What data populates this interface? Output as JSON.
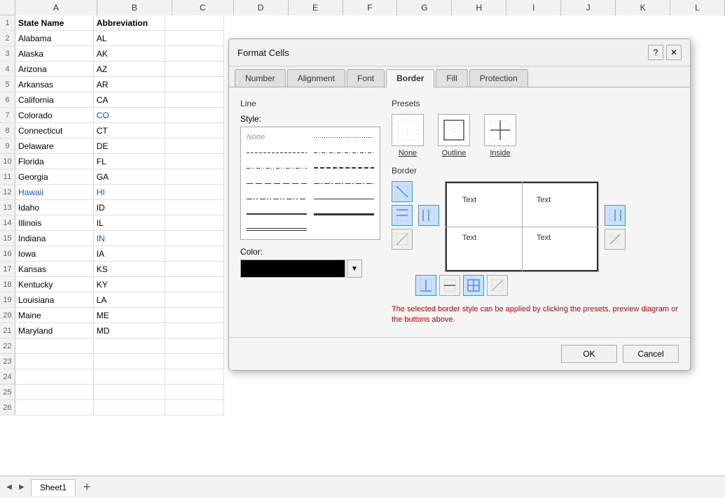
{
  "spreadsheet": {
    "columns": [
      "",
      "A",
      "B",
      "C",
      "D",
      "E",
      "F",
      "G",
      "H",
      "I",
      "J",
      "K",
      "L"
    ],
    "rows": [
      {
        "num": "1",
        "a": "State Name",
        "b": "Abbreviation",
        "isHeader": true
      },
      {
        "num": "2",
        "a": "Alabama",
        "b": "AL"
      },
      {
        "num": "3",
        "a": "Alaska",
        "b": "AK"
      },
      {
        "num": "4",
        "a": "Arizona",
        "b": "AZ"
      },
      {
        "num": "5",
        "a": "Arkansas",
        "b": "AR"
      },
      {
        "num": "6",
        "a": "California",
        "b": "CA"
      },
      {
        "num": "7",
        "a": "Colorado",
        "b": "CO",
        "bBlue": true
      },
      {
        "num": "8",
        "a": "Connecticut",
        "b": "CT"
      },
      {
        "num": "9",
        "a": "Delaware",
        "b": "DE"
      },
      {
        "num": "10",
        "a": "Florida",
        "b": "FL"
      },
      {
        "num": "11",
        "a": "Georgia",
        "b": "GA"
      },
      {
        "num": "12",
        "a": "Hawaii",
        "b": "HI",
        "aBlue": true,
        "bBlue": true
      },
      {
        "num": "13",
        "a": "Idaho",
        "b": "ID"
      },
      {
        "num": "14",
        "a": "Illinois",
        "b": "IL"
      },
      {
        "num": "15",
        "a": "Indiana",
        "b": "IN",
        "bBlue": true
      },
      {
        "num": "16",
        "a": "Iowa",
        "b": "IA"
      },
      {
        "num": "17",
        "a": "Kansas",
        "b": "KS"
      },
      {
        "num": "18",
        "a": "Kentucky",
        "b": "KY"
      },
      {
        "num": "19",
        "a": "Louisiana",
        "b": "LA"
      },
      {
        "num": "20",
        "a": "Maine",
        "b": "ME"
      },
      {
        "num": "21",
        "a": "Maryland",
        "b": "MD"
      },
      {
        "num": "22",
        "a": "",
        "b": ""
      },
      {
        "num": "23",
        "a": "",
        "b": ""
      },
      {
        "num": "24",
        "a": "",
        "b": ""
      },
      {
        "num": "25",
        "a": "",
        "b": ""
      },
      {
        "num": "26",
        "a": "",
        "b": ""
      }
    ]
  },
  "sheet_tab": {
    "name": "Sheet1"
  },
  "dialog": {
    "title": "Format Cells",
    "help_btn": "?",
    "close_btn": "✕",
    "tabs": [
      {
        "label": "Number",
        "active": false
      },
      {
        "label": "Alignment",
        "active": false
      },
      {
        "label": "Font",
        "active": false
      },
      {
        "label": "Border",
        "active": true
      },
      {
        "label": "Fill",
        "active": false
      },
      {
        "label": "Protection",
        "active": false
      }
    ],
    "line_section": {
      "title": "Line",
      "style_label": "Style:",
      "none_label": "None",
      "color_label": "Color:"
    },
    "presets_section": {
      "title": "Presets",
      "items": [
        {
          "label": "None"
        },
        {
          "label": "Outline"
        },
        {
          "label": "Inside"
        }
      ]
    },
    "border_section": {
      "title": "Border"
    },
    "preview_texts": [
      "Text",
      "Text",
      "Text",
      "Text"
    ],
    "info_text": "The selected border style can be applied by clicking the presets, preview diagram or the buttons above.",
    "ok_btn": "OK",
    "cancel_btn": "Cancel"
  }
}
